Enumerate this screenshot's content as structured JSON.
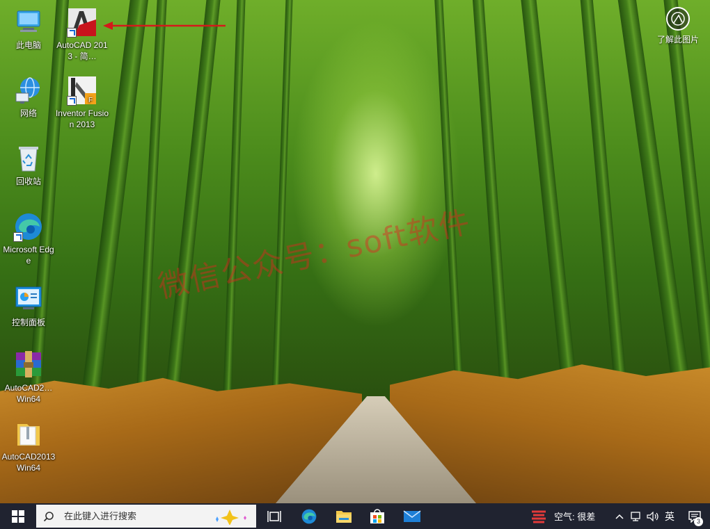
{
  "desktop": {
    "icons": [
      {
        "label": "此电脑"
      },
      {
        "label": "网络"
      },
      {
        "label": "回收站"
      },
      {
        "label": "Microsoft Edge"
      },
      {
        "label": "控制面板"
      },
      {
        "label": "AutoCAD2… Win64"
      },
      {
        "label": "AutoCAD2013 Win64"
      },
      {
        "label": "AutoCAD 2013 - 简…"
      },
      {
        "label": "Inventor Fusion 2013"
      }
    ],
    "learn_label": "了解此图片",
    "watermark": "微信公众号：soft软件"
  },
  "taskbar": {
    "search_placeholder": "在此键入进行搜索",
    "weather_text": "空气: 很差",
    "ime_label": "英",
    "notification_count": "3"
  },
  "colors": {
    "taskbar_bg": "#202330",
    "arrow": "#d31a1a"
  }
}
